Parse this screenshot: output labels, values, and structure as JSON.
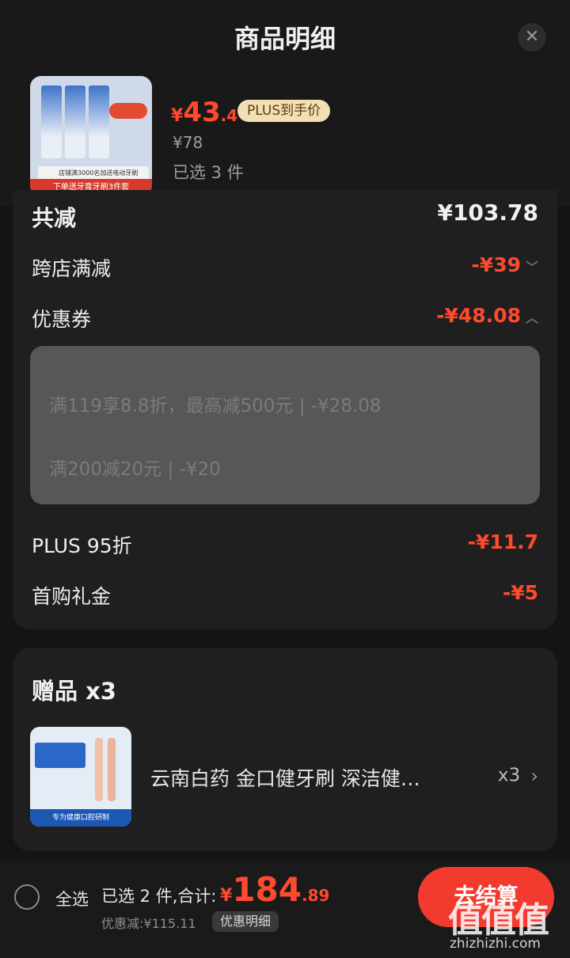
{
  "header": {
    "title": "商品明细",
    "close_glyph": "✕"
  },
  "product": {
    "price_symbol": "¥",
    "price_int": "43",
    "price_dec": ".4",
    "plus_tag": "PLUS到手价",
    "original_price": "¥78",
    "selected_count": "已选 3 件",
    "thumb_strip1": "店铺满3000名加送电动牙刷",
    "thumb_strip2": "下单送牙膏牙刷3件套"
  },
  "discounts": {
    "total_label": "共减",
    "total_value": "¥103.78",
    "items": [
      {
        "label": "跨店满减",
        "value": "-¥39",
        "chevron": "﹀"
      },
      {
        "label": "优惠券",
        "value": "-¥48.08",
        "chevron": "︿"
      },
      {
        "label": "PLUS 95折",
        "value": "-¥11.7"
      },
      {
        "label": "首购礼金",
        "value": "-¥5"
      }
    ],
    "coupons": [
      "满119享8.8折，最高减500元 | -¥28.08",
      "满200减20元 | -¥20"
    ]
  },
  "gifts": {
    "title": "赠品 x3",
    "item_name": "云南白药 金口健牙刷 深洁健…",
    "item_qty": "x3",
    "chevron": "›",
    "thumb_banner": "专为健康口腔研制"
  },
  "bottom_bar": {
    "select_all": "全选",
    "summary_label": "已选 2 件,合计:",
    "total_symbol": "¥",
    "total_int": "184",
    "total_dec": ".89",
    "saved_text": "优惠减:¥115.11",
    "detail_button": "优惠明细",
    "checkout_button": "去结算"
  },
  "watermark": {
    "brand": "值值值",
    "url": "zhizhizhi.com"
  },
  "colors": {
    "accent": "#ff4a2e",
    "background": "#141414",
    "card": "#1f1f1f",
    "checkout": "#f23b2e"
  }
}
